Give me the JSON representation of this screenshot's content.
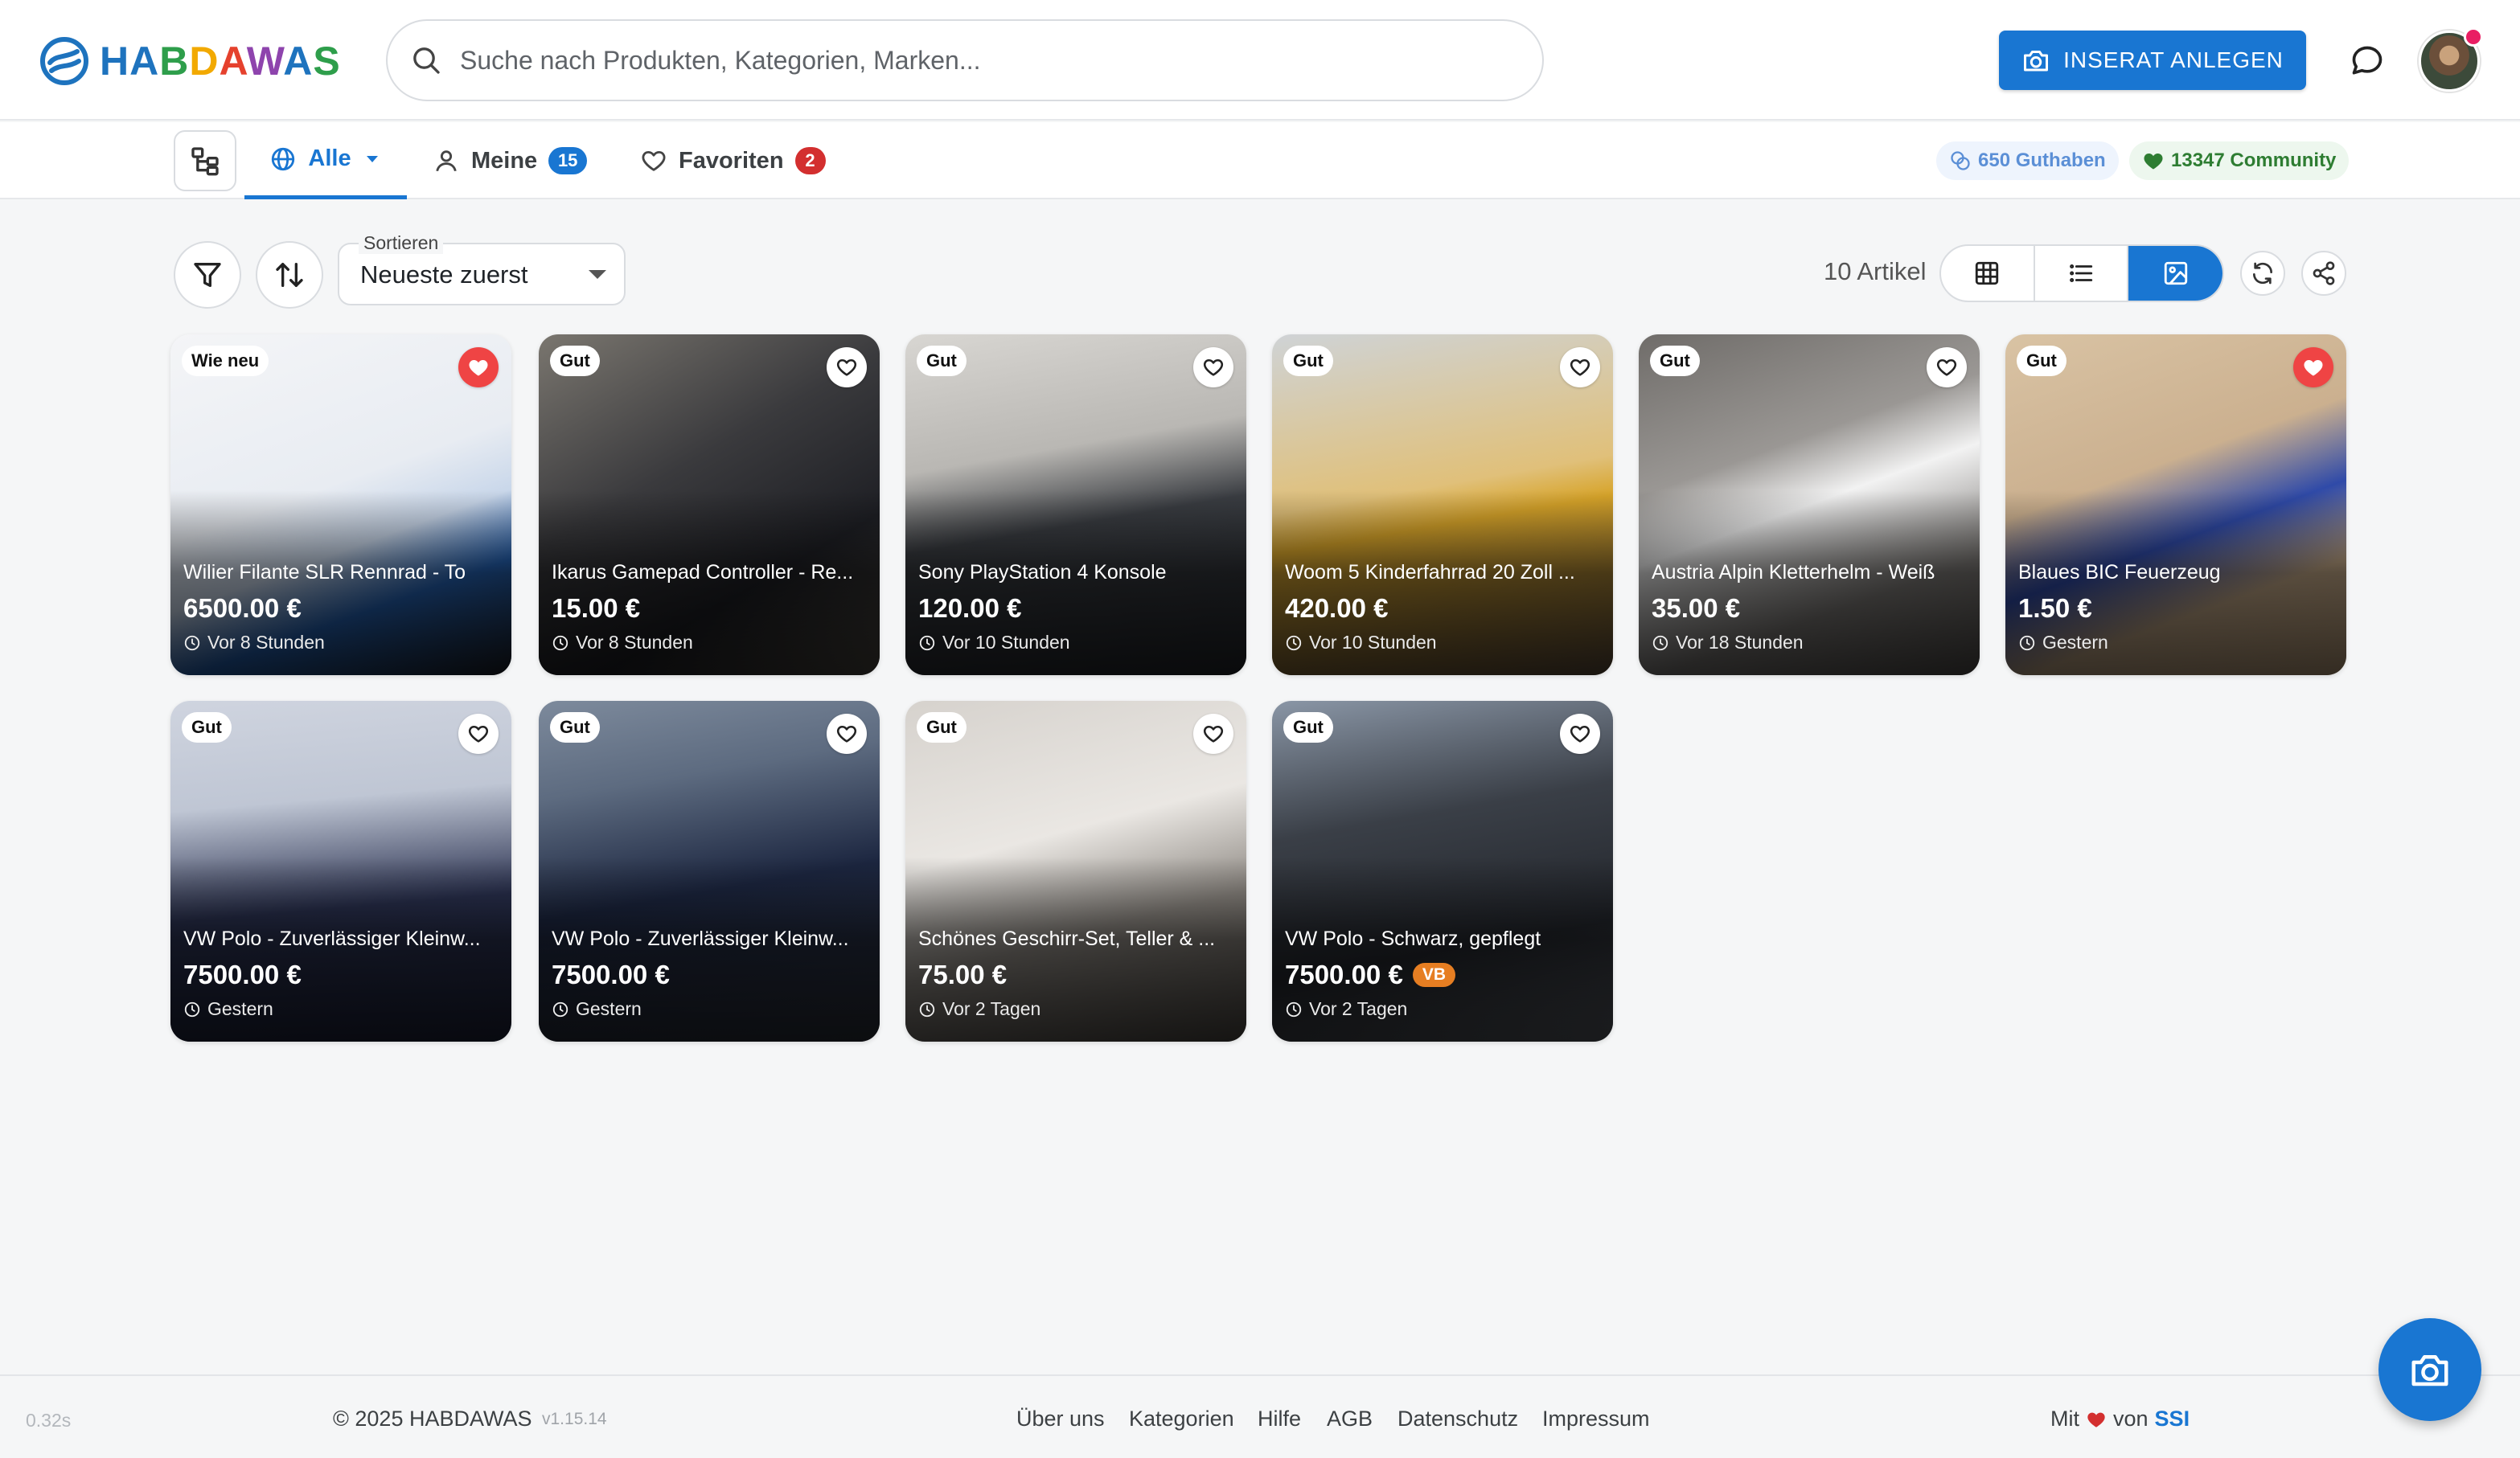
{
  "brand": {
    "name": "HABDAWAS",
    "letter_colors": [
      "#1e73be",
      "#1e73be",
      "#2e9e4b",
      "#f2a900",
      "#e5412d",
      "#8e44ad",
      "#1e73be",
      "#2e9e4b"
    ]
  },
  "header": {
    "search_placeholder": "Suche nach Produkten, Kategorien, Marken...",
    "cta_label": "INSERAT ANLEGEN",
    "accent": "#1976d2"
  },
  "subnav": {
    "tabs": [
      {
        "label": "Alle",
        "icon": "globe-icon",
        "active": true,
        "has_dropdown": true
      },
      {
        "label": "Meine",
        "icon": "user-icon",
        "badge": "15",
        "badge_color": "#1976d2"
      },
      {
        "label": "Favoriten",
        "icon": "heart-outline-icon",
        "badge": "2",
        "badge_color": "#d32f2f"
      }
    ],
    "credit_label": "650 Guthaben",
    "community_label": "13347 Community"
  },
  "toolbar": {
    "sort_label": "Sortieren",
    "sort_value": "Neueste zuerst",
    "count_label": "10 Artikel",
    "views": [
      "grid-view",
      "list-view",
      "gallery-view"
    ],
    "active_view": "gallery-view"
  },
  "listings": [
    {
      "title": "Wilier Filante SLR Rennrad - To",
      "price": "6500.00 €",
      "time": "Vor 8 Stunden",
      "condition": "Wie neu",
      "favorite": true
    },
    {
      "title": "Ikarus Gamepad Controller - Re...",
      "price": "15.00 €",
      "time": "Vor 8 Stunden",
      "condition": "Gut",
      "favorite": false
    },
    {
      "title": "Sony PlayStation 4 Konsole",
      "price": "120.00 €",
      "time": "Vor 10 Stunden",
      "condition": "Gut",
      "favorite": false
    },
    {
      "title": "Woom 5 Kinderfahrrad 20 Zoll ...",
      "price": "420.00 €",
      "time": "Vor 10 Stunden",
      "condition": "Gut",
      "favorite": false
    },
    {
      "title": "Austria Alpin Kletterhelm - Weiß",
      "price": "35.00 €",
      "time": "Vor 18 Stunden",
      "condition": "Gut",
      "favorite": false
    },
    {
      "title": "Blaues BIC Feuerzeug",
      "price": "1.50 €",
      "time": "Gestern",
      "condition": "Gut",
      "favorite": true
    },
    {
      "title": "VW Polo - Zuverlässiger Kleinw...",
      "price": "7500.00 €",
      "time": "Gestern",
      "condition": "Gut",
      "favorite": false
    },
    {
      "title": "VW Polo - Zuverlässiger Kleinw...",
      "price": "7500.00 €",
      "time": "Gestern",
      "condition": "Gut",
      "favorite": false
    },
    {
      "title": "Schönes Geschirr-Set, Teller & ...",
      "price": "75.00 €",
      "time": "Vor 2 Tagen",
      "condition": "Gut",
      "favorite": false
    },
    {
      "title": "VW Polo - Schwarz, gepflegt",
      "price": "7500.00 €",
      "time": "Vor 2 Tagen",
      "condition": "Gut",
      "favorite": false,
      "price_tag": "VB"
    }
  ],
  "footer": {
    "load_time": "0.32s",
    "copyright": "© 2025 HABDAWAS",
    "version": "v1.15.14",
    "links": [
      "Über uns",
      "Kategorien",
      "Hilfe",
      "AGB",
      "Datenschutz",
      "Impressum"
    ],
    "made_with_prefix": "Mit",
    "made_with_suffix": "von",
    "made_by": "SSI"
  }
}
